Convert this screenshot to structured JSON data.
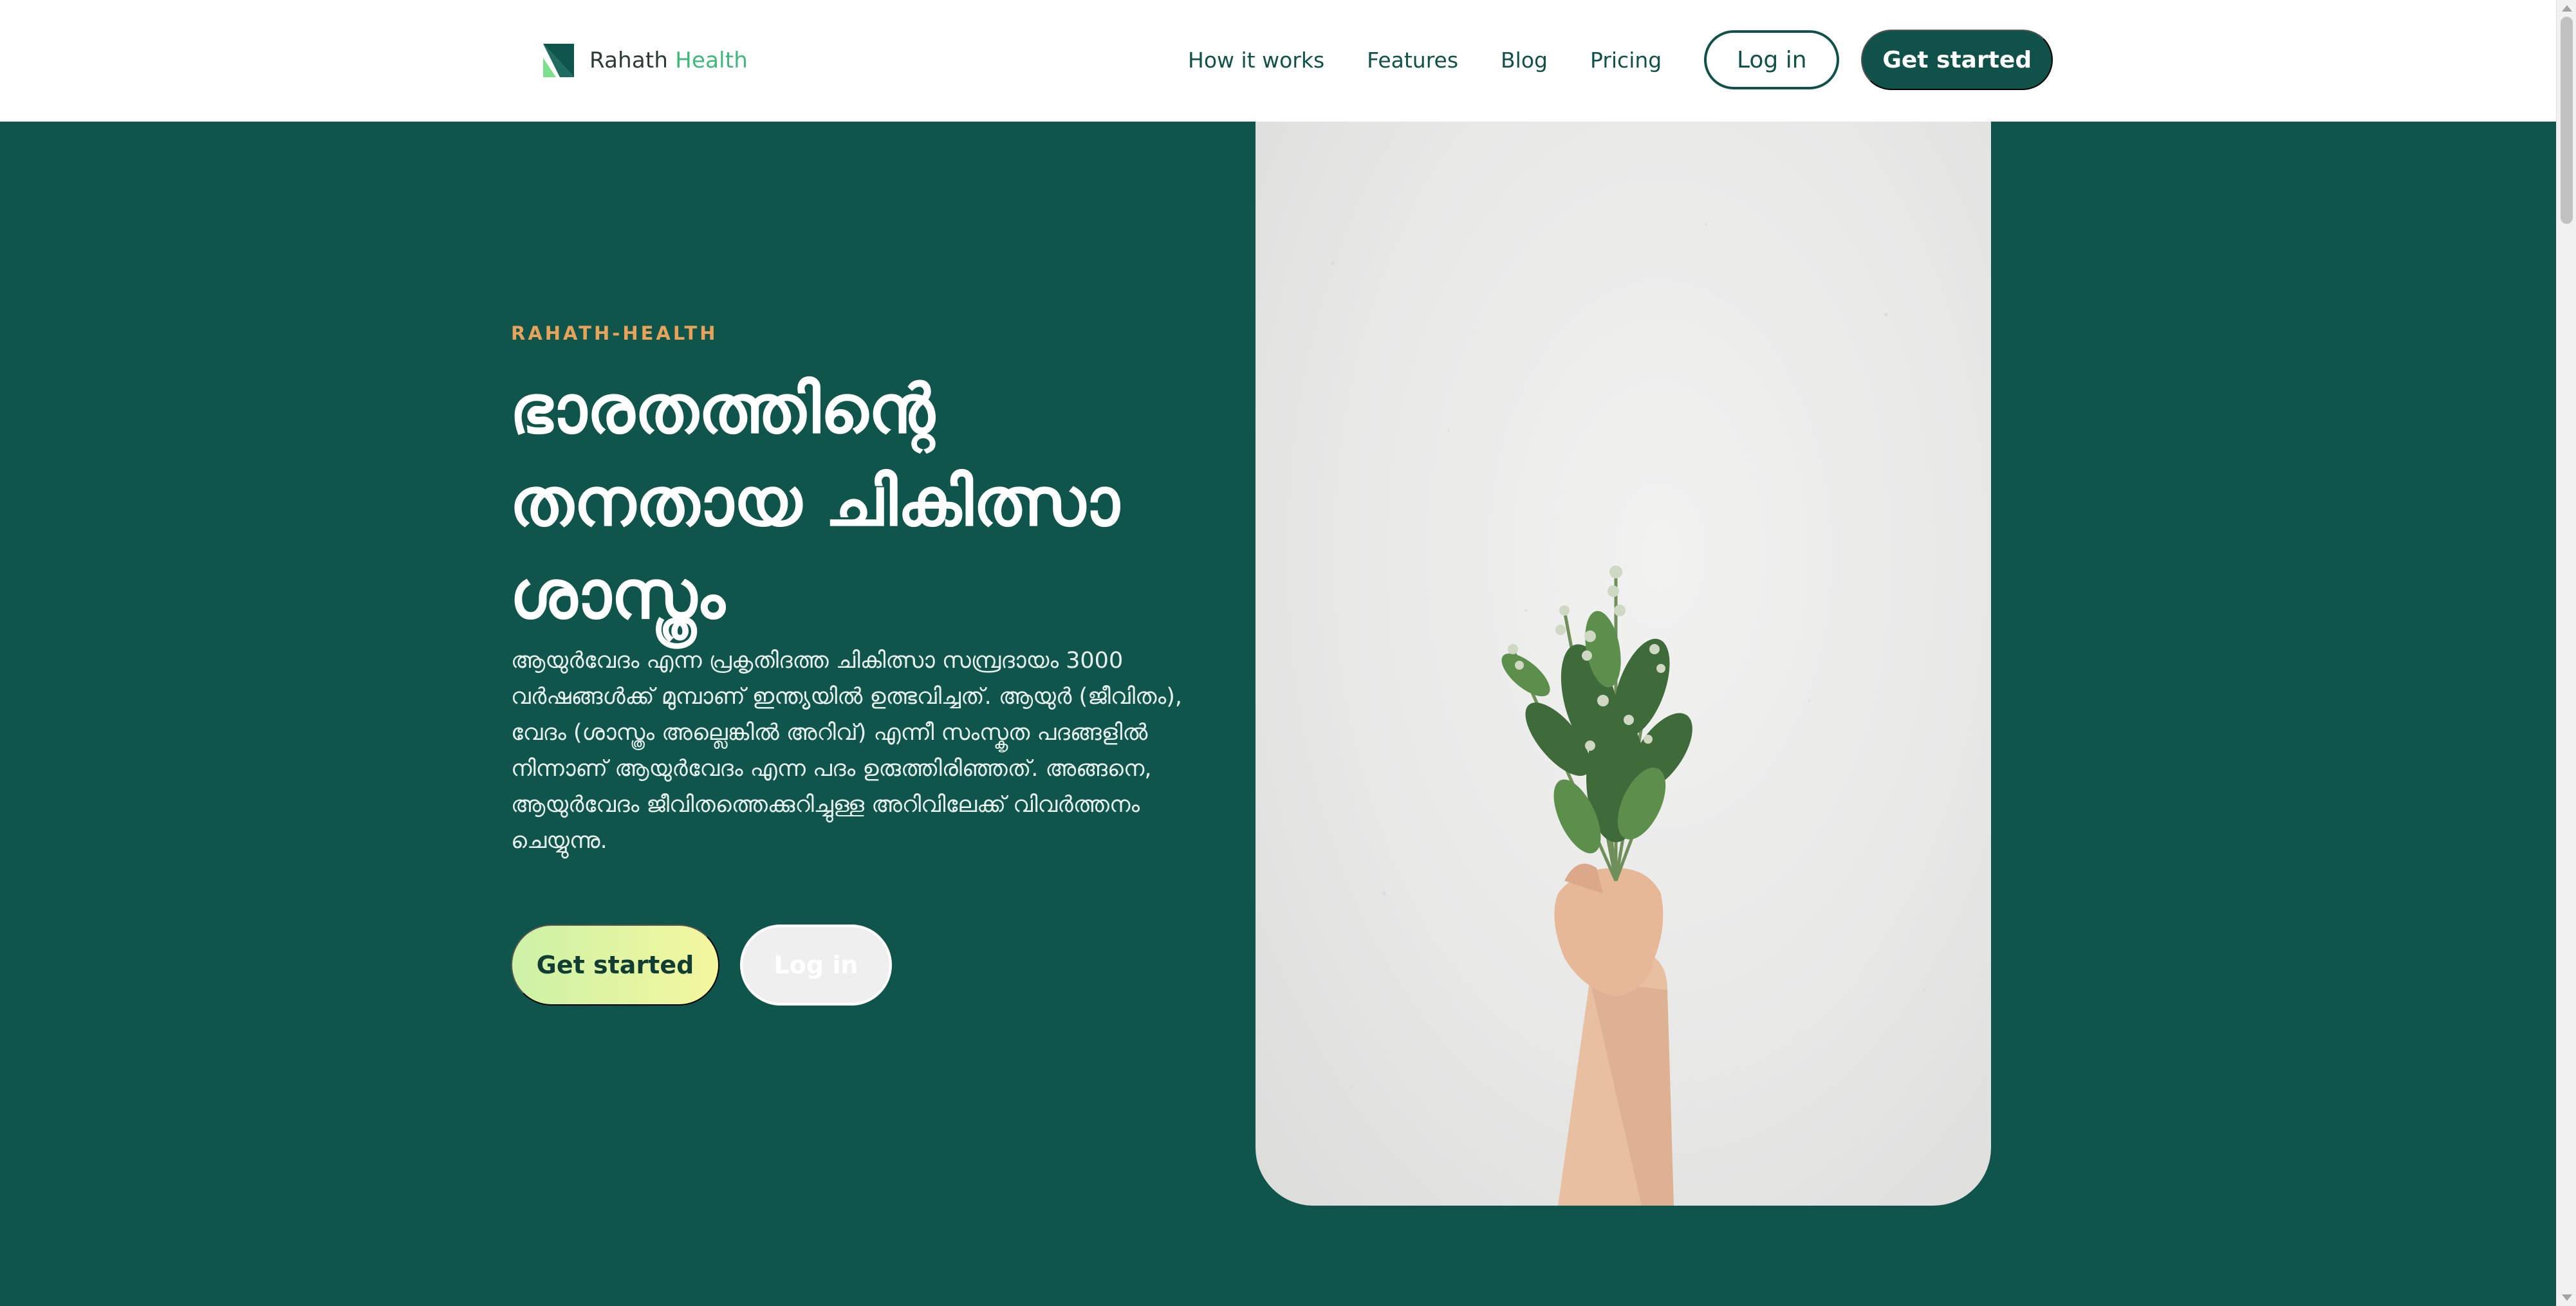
{
  "header": {
    "brand": {
      "name": "Rahath",
      "accent": "Health",
      "logo_icon": "leaf-logo-icon"
    },
    "nav": [
      {
        "label": "How it works"
      },
      {
        "label": "Features"
      },
      {
        "label": "Blog"
      },
      {
        "label": "Pricing"
      }
    ],
    "login_label": "Log in",
    "cta_label": "Get started"
  },
  "hero": {
    "eyebrow": "RAHATH-HEALTH",
    "headline": "ഭാരതത്തിന്റെ തനതായ ചികിത്സാ ശാസ്ത്രം",
    "body": "ആയുർവേദം എന്ന പ്രകൃതിദത്ത ചികിത്സാ സമ്പ്രദായം 3000 വർഷങ്ങൾക്ക് മുമ്പാണ് ഇന്ത്യയിൽ ഉത്ഭവിച്ചത്. ആയുർ (ജീവിതം), വേദം (ശാസ്ത്രം അല്ലെങ്കിൽ അറിവ്) എന്നീ സംസ്കൃത പദങ്ങളിൽ നിന്നാണ് ആയുർവേദം എന്ന പദം ഉരുത്തിരിഞ്ഞത്. അങ്ങനെ, ആയുർവേദം ജീവിതത്തെക്കുറിച്ചുള്ള അറിവിലേക്ക് വിവർത്തനം ചെയ്യുന്നു.",
    "primary_cta": "Get started",
    "secondary_cta": "Log in",
    "image_subject": "hand-holding-herbs-image"
  },
  "colors": {
    "brand_dark": "#10554b",
    "accent_green": "#3fb97a",
    "eyebrow_orange": "#e8a35a",
    "cta_gradient_start": "#ccf2a6",
    "cta_gradient_end": "#f4f79e"
  }
}
